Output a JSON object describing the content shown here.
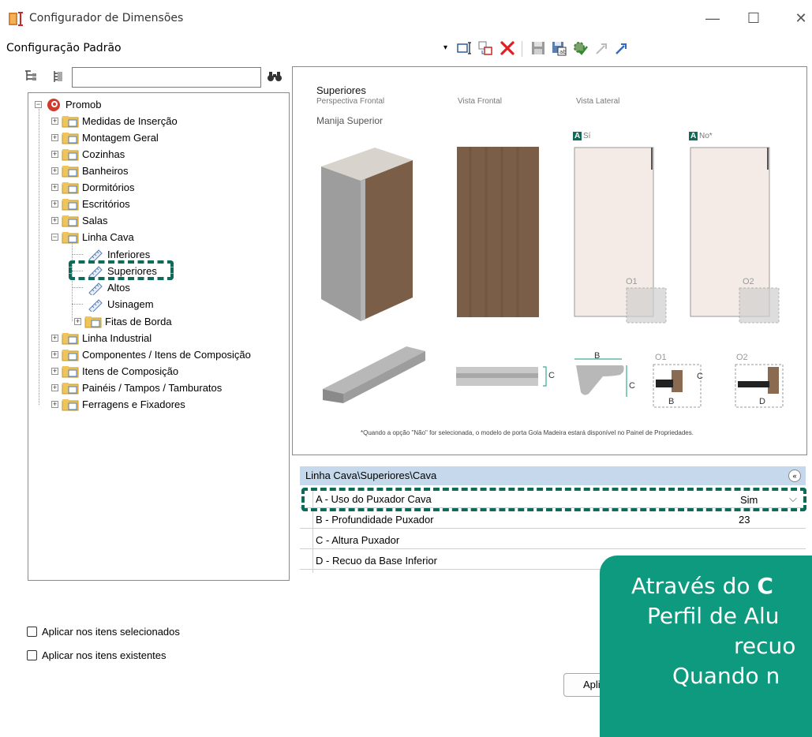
{
  "window": {
    "title": "Configurador de Dimensões",
    "minimize": "—",
    "maximize": "☐",
    "close": "✕"
  },
  "config": {
    "name": "Configuração Padrão",
    "dropdown_caret": "▾"
  },
  "tree": {
    "search_value": "",
    "root": "Promob",
    "items": [
      "Medidas de Inserção",
      "Montagem Geral",
      "Cozinhas",
      "Banheiros",
      "Dormitórios",
      "Escritórios",
      "Salas",
      "Linha Cava",
      "Inferiores",
      "Superiores",
      "Altos",
      "Usinagem",
      "Fitas de Borda",
      "Linha Industrial",
      "Componentes / Itens de Composição",
      "Itens de Composição",
      "Painéis / Tampos / Tamburatos",
      "Ferragens e Fixadores"
    ]
  },
  "checkboxes": {
    "selected": "Aplicar nos itens selecionados",
    "existing": "Aplicar nos itens existentes"
  },
  "preview": {
    "title": "Superiores",
    "perspective": "Perspectiva Frontal",
    "front": "Vista Frontal",
    "side": "Vista Lateral",
    "handle": "Manija Superior",
    "badge_a": "A",
    "opt_yes": "Sí",
    "opt_no": "No*",
    "o1": "O1",
    "o2": "O2",
    "b": "B",
    "c": "C",
    "d": "D",
    "footnote": "*Quando a opção \"Não\" for selecionada, o modelo de porta Gola Madeira estará disponível no Painel de Propriedades."
  },
  "properties": {
    "path": "Linha Cava\\Superiores\\Cava",
    "collapse": "«",
    "rows": [
      {
        "label": "A - Uso do Puxador Cava",
        "value": "Sim"
      },
      {
        "label": "B - Profundidade Puxador",
        "value": "23"
      },
      {
        "label": "C - Altura Puxador",
        "value": ""
      },
      {
        "label": "D - Recuo da Base Inferior",
        "value": ""
      }
    ]
  },
  "apply_button": "Aplicar",
  "callout": {
    "line1_pre": "Através do ",
    "line1_bold": "C",
    "line2": "Perfil de Alu",
    "line3": "recuo",
    "line4": "Quando n"
  },
  "colors": {
    "accent": "#0e9a7e",
    "highlight": "#0e6b59",
    "header": "#c6d8ec",
    "delete": "#e02020"
  }
}
